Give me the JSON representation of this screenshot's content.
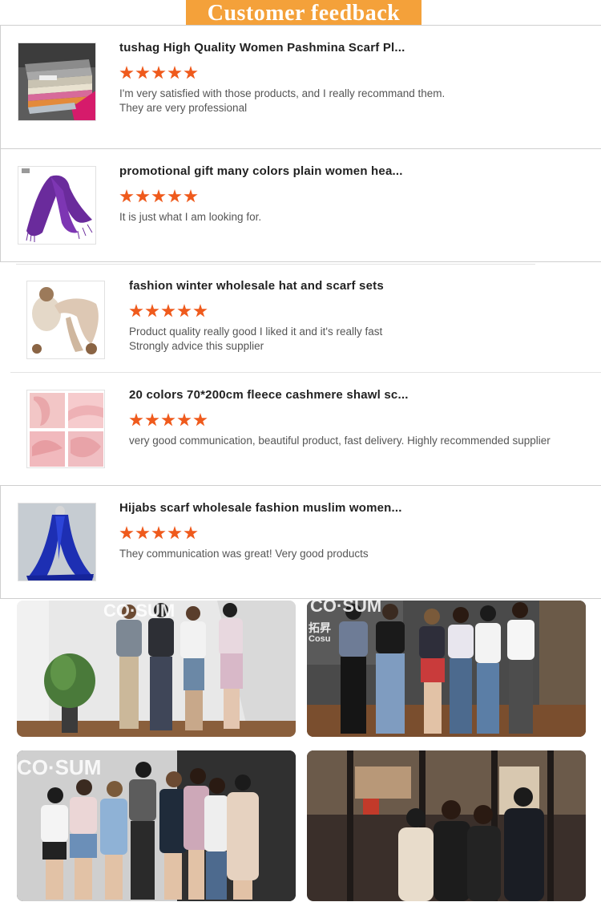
{
  "header": {
    "title": "Customer feedback",
    "color": "#f4a13a"
  },
  "star_color": "#ef5a1c",
  "reviews": [
    {
      "title": "tushag High Quality Women Pashmina Scarf Pl...",
      "rating": 5,
      "text_lines": [
        "I'm very satisfied with those products, and I really recommand them.",
        "They are very professional"
      ]
    },
    {
      "title": "promotional gift many colors plain women hea...",
      "rating": 5,
      "text_lines": [
        "It is just what I am looking for.",
        ""
      ]
    },
    {
      "title": "fashion winter wholesale hat and scarf sets",
      "rating": 5,
      "text_lines": [
        "Product quality really good I liked it and it's really fast",
        "Strongly advice this supplier"
      ]
    },
    {
      "title": "20 colors 70*200cm fleece cashmere shawl sc...",
      "rating": 5,
      "text_lines": [
        "very good communication, beautiful product, fast delivery. Highly recommended supplier",
        ""
      ]
    },
    {
      "title": "Hijabs scarf wholesale fashion muslim women...",
      "rating": 5,
      "text_lines": [
        "They communication was great! Very good products",
        ""
      ]
    }
  ],
  "photos": {
    "p1": {
      "sign": "CO·SUM"
    },
    "p2": {
      "sign_top": "CO·SUM",
      "sign_cn": "拓昇",
      "sign_en": "Cosu"
    },
    "p3": {
      "sign": "CO·SUM"
    }
  }
}
